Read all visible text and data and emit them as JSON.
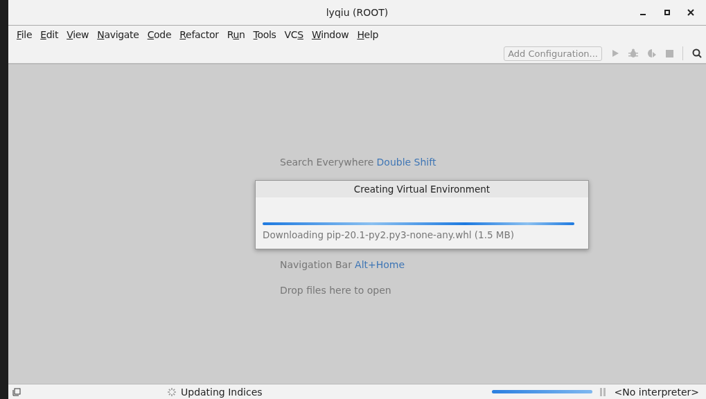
{
  "window": {
    "title": "lyqiu (ROOT)"
  },
  "menu": [
    {
      "key": "F",
      "after": "ile"
    },
    {
      "key": "E",
      "after": "dit"
    },
    {
      "key": "V",
      "after": "iew"
    },
    {
      "key": "N",
      "after": "avigate"
    },
    {
      "key": "C",
      "after": "ode"
    },
    {
      "key": "R",
      "after": "efactor"
    },
    {
      "before": "R",
      "key": "u",
      "after": "n"
    },
    {
      "key": "T",
      "after": "ools"
    },
    {
      "before": "VC",
      "key": "S"
    },
    {
      "key": "W",
      "after": "indow"
    },
    {
      "key": "H",
      "after": "elp"
    }
  ],
  "toolbar": {
    "configuration": "Add Configuration..."
  },
  "hints": [
    {
      "text": "Search Everywhere",
      "shortcut": "Double Shift"
    },
    {
      "text": "Navigation Bar",
      "shortcut": "Alt+Home"
    },
    {
      "text": "Drop files here to open"
    }
  ],
  "dialog": {
    "title": "Creating Virtual Environment",
    "level": 1,
    "status": "Downloading pip-20.1-py2.py3-none-any.whl (1.5 MB)"
  },
  "status_bar": {
    "task": "Updating Indices",
    "level": 1,
    "interpreter": "<No interpreter>"
  }
}
